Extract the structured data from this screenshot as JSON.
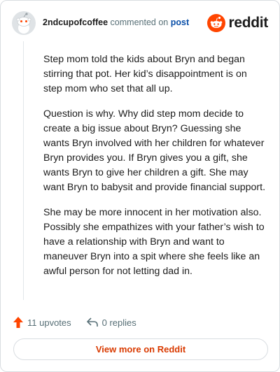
{
  "header": {
    "username": "2ndcupofcoffee",
    "action_text": "commented on",
    "post_link": "post",
    "brand": "reddit"
  },
  "comment": {
    "paragraphs": [
      "Step mom told the kids about Bryn and began stirring that pot. Her kid’s disappointment is on step mom who set that all up.",
      "Question is why. Why did step mom decide to create a big issue about Bryn? Guessing she wants Bryn involved with her children for whatever Bryn provides you. If Bryn gives you a gift, she wants Bryn to give her children a gift. She may want Bryn to babysit and provide financial support.",
      "She may be more innocent in her motivation also. Possibly she empathizes with your father’s wish to have a relationship with Bryn and want to maneuver Bryn into a spit where she feels like an awful person for not letting dad in."
    ]
  },
  "actions": {
    "upvotes": "11 upvotes",
    "replies": "0 replies"
  },
  "view_more": "View more on Reddit",
  "colors": {
    "accent": "#ff4500",
    "link": "#0a4fa8",
    "muted": "#576f76"
  },
  "icons": {
    "avatar": "snoo-avatar-icon",
    "logo": "reddit-logo-icon",
    "upvote": "upvote-arrow-icon",
    "reply": "reply-arrow-icon"
  }
}
